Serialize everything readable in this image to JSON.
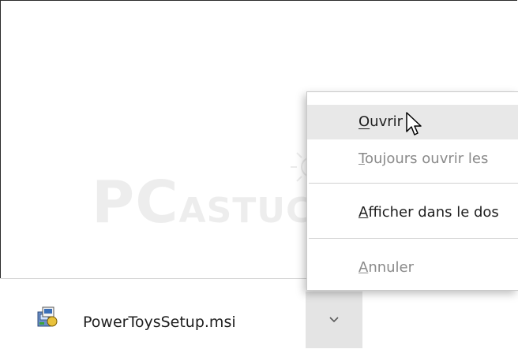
{
  "watermark": {
    "pc": "PC",
    "astuces": "ASTUCES"
  },
  "download_bar": {
    "file_name": "PowerToysSetup.msi",
    "file_icon": "msi-installer-icon",
    "menu_button_icon": "chevron-down-icon"
  },
  "context_menu": {
    "items": [
      {
        "label": "Ouvrir",
        "accesskey": "O",
        "state": "hover"
      },
      {
        "label": "Toujours ouvrir les",
        "accesskey": "T",
        "state": "disabled"
      },
      {
        "label": "Afficher dans le dos",
        "accesskey": "A",
        "state": "normal"
      },
      {
        "label": "Annuler",
        "accesskey": "A",
        "state": "disabled"
      }
    ]
  },
  "colors": {
    "menu_hover": "#e8e8e8",
    "button_bg": "#e4e4e4",
    "disabled_text": "#8a8a8a"
  }
}
